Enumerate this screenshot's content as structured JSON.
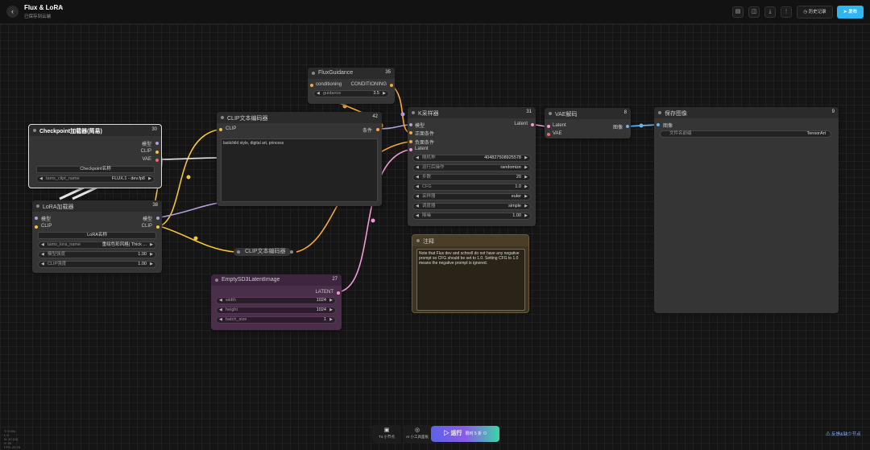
{
  "header": {
    "title": "Flux & LoRA",
    "subtitle": "已保存到云端",
    "history_label": "历史记录",
    "publish_label": "发布",
    "back_icon": "‹",
    "edit_icon": "✎"
  },
  "toolbar_icons": [
    "document-icon",
    "stack-icon",
    "download-icon",
    "more-icon"
  ],
  "nodes": {
    "checkpoint": {
      "title": "Checkpoint加载器(简易)",
      "id": "30",
      "out_model": "模型",
      "out_clip": "CLIP",
      "out_vae": "VAE",
      "name_label": "Checkpoint名称",
      "widget_label": "tams_clipt_name",
      "widget_value": "FLUX.1 - dev.fp8"
    },
    "lora": {
      "title": "LoRA加载器",
      "id": "38",
      "in_model": "模型",
      "in_clip": "CLIP",
      "out_model": "模型",
      "out_clip": "CLIP",
      "name_label": "LoRA名称",
      "w1_label": "tams_lora_name",
      "w1_value": "重绘色彩风格| Thick ...",
      "w2_label": "模型强度",
      "w2_value": "1.00",
      "w3_label": "CLIP强度",
      "w3_value": "1.00"
    },
    "clip_text": {
      "title": "CLIP文本编码器",
      "id": "42",
      "in_clip": "CLIP",
      "out_cond": "条件",
      "text": "lastichild style, digital art, princess"
    },
    "clip_text2": {
      "title": "CLIP文本编码器"
    },
    "flux_guidance": {
      "title": "FluxGuidance",
      "id": "35",
      "in": "conditioning",
      "out": "CONDITIONING",
      "w_label": "guidance",
      "w_value": "3.5"
    },
    "ksampler": {
      "title": "K采样器",
      "id": "31",
      "in_model": "模型",
      "in_pos": "正面条件",
      "in_neg": "负面条件",
      "in_latent": "Latent",
      "out": "Latent",
      "widgets": [
        {
          "label": "随机种",
          "value": "404827508925578"
        },
        {
          "label": "运行后操作",
          "value": "randomize"
        },
        {
          "label": "步数",
          "value": "20"
        },
        {
          "label": "CFG",
          "value": "1.0"
        },
        {
          "label": "采样器",
          "value": "euler"
        },
        {
          "label": "调度器",
          "value": "simple"
        },
        {
          "label": "降噪",
          "value": "1.00"
        }
      ]
    },
    "vae_decode": {
      "title": "VAE解码",
      "id": "8",
      "in_latent": "Latent",
      "in_vae": "VAE",
      "out": "图像"
    },
    "save_image": {
      "title": "保存图像",
      "id": "9",
      "in_image": "图像",
      "w_label": "文件名前缀",
      "w_value": "TensorArt"
    },
    "note": {
      "title": "注释",
      "text": "Note that Flux dev and schnell do not have any negative prompt so CFG should be set to 1.0. Setting CFG to 1.0 means the negative prompt is ignored."
    },
    "latent": {
      "title": "EmptySD3LatentImage",
      "id": "27",
      "out": "LATENT",
      "widgets": [
        {
          "label": "width",
          "value": "1024"
        },
        {
          "label": "height",
          "value": "1024"
        },
        {
          "label": "batch_size",
          "value": "1"
        }
      ]
    }
  },
  "bottombar": {
    "item1_label": "T4 小节点",
    "item2_label": "AI 小工具面板",
    "run_label": "运行",
    "run_sub": "限时 5 折 ⊙"
  },
  "debug": "T: 0.00s\nI: 0\nN: 10 [10]\nV: 20\nFPS: 29.78",
  "feedback_label": "反馈&缺少节点",
  "colors": {
    "clip": "#f3c33b",
    "model": "#b39ddb",
    "vae": "#ef6b6b",
    "latent": "#f09ad8",
    "cond": "#f5a742",
    "image": "#64b5f6",
    "latent_node": "#4a2e4a",
    "note": "#3d3424",
    "accent": "#2fb6f0"
  }
}
